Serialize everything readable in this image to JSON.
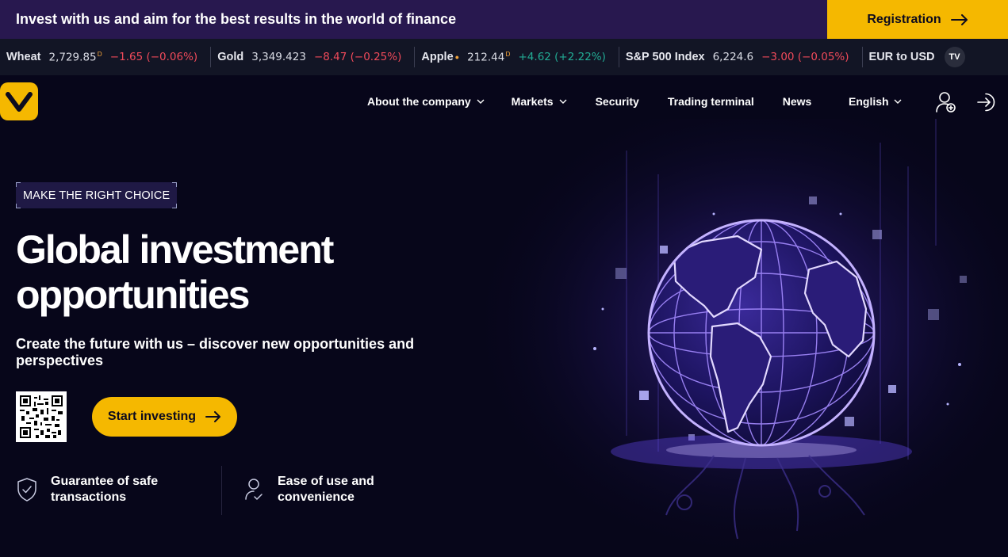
{
  "promo": {
    "text": "Invest with us and aim for the best results in the world of finance",
    "registration_label": "Registration"
  },
  "ticker": [
    {
      "symbol": "Wheat",
      "price": "2,729.85",
      "flag": "D",
      "change": "−1.65 (−0.06%)",
      "direction": "down"
    },
    {
      "symbol": "Gold",
      "price": "3,349.423",
      "flag": "",
      "change": "−8.47 (−0.25%)",
      "direction": "down"
    },
    {
      "symbol": "Apple",
      "price": "212.44",
      "flag": "D",
      "change": "+4.62 (+2.22%)",
      "direction": "up"
    },
    {
      "symbol": "S&P 500 Index",
      "price": "6,224.6",
      "flag": "",
      "change": "−3.00 (−0.05%)",
      "direction": "down"
    },
    {
      "symbol": "EUR to USD",
      "price": "",
      "flag": "",
      "change": "",
      "direction": ""
    }
  ],
  "ticker_badge": "TV",
  "nav": {
    "items": [
      {
        "label": "About the company",
        "dropdown": true
      },
      {
        "label": "Markets",
        "dropdown": true
      },
      {
        "label": "Security",
        "dropdown": false
      },
      {
        "label": "Trading terminal",
        "dropdown": false
      },
      {
        "label": "News",
        "dropdown": false
      }
    ],
    "language": "English",
    "icons": [
      "user-add-icon",
      "login-icon"
    ]
  },
  "hero": {
    "tagline": "MAKE THE RIGHT CHOICE",
    "title_line1": "Global investment",
    "title_line2": "opportunities",
    "subtitle": "Create the future with us – discover new opportunities and perspectives",
    "cta_label": "Start investing"
  },
  "features": [
    {
      "icon": "shield-check-icon",
      "line1": "Guarantee of safe",
      "line2": "transactions"
    },
    {
      "icon": "user-check-icon",
      "line1": "Ease of use and",
      "line2": "convenience"
    }
  ],
  "colors": {
    "accent": "#f5b800",
    "background": "#07061a",
    "promo_bar": "#28184f",
    "ticker_bar": "#121525",
    "negative": "#f04a5a",
    "positive": "#22ab94",
    "globe": "#8b6bff"
  }
}
